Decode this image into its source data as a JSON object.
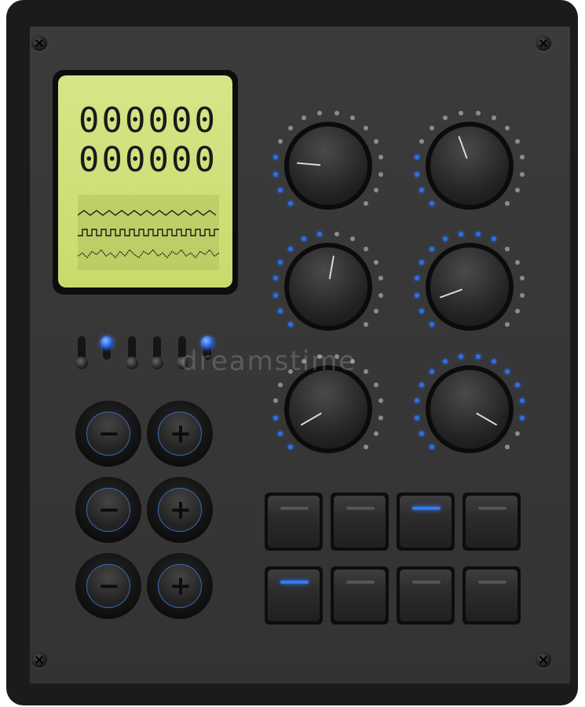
{
  "lcd": {
    "line1": "000000",
    "line2": "000000",
    "background": "#d2e17f",
    "waveforms": [
      "triangle-wave",
      "square-wave",
      "noise-wave"
    ]
  },
  "toggle_switches": [
    {
      "on": false
    },
    {
      "on": true
    },
    {
      "on": false
    },
    {
      "on": false
    },
    {
      "on": false
    },
    {
      "on": true
    }
  ],
  "plus_minus_buttons": [
    {
      "minus": "−",
      "plus": "+"
    },
    {
      "minus": "−",
      "plus": "+"
    },
    {
      "minus": "−",
      "plus": "+"
    }
  ],
  "knobs": [
    {
      "name": "knob-1",
      "angle_deg": 95,
      "leds_on": 4
    },
    {
      "name": "knob-2",
      "angle_deg": 160,
      "leds_on": 4
    },
    {
      "name": "knob-3",
      "angle_deg": 190,
      "leds_on": 8
    },
    {
      "name": "knob-4",
      "angle_deg": 70,
      "leds_on": 10
    },
    {
      "name": "knob-5",
      "angle_deg": 60,
      "leds_on": 3
    },
    {
      "name": "knob-6",
      "angle_deg": 300,
      "leds_on": 14
    }
  ],
  "rocker_switches": [
    {
      "lit": false
    },
    {
      "lit": false
    },
    {
      "lit": true
    },
    {
      "lit": false
    },
    {
      "lit": true
    },
    {
      "lit": false
    },
    {
      "lit": false
    },
    {
      "lit": false
    }
  ],
  "watermark": "dreamstime",
  "colors": {
    "led_on": "#2c6fe6",
    "led_off": "#8c8c8c",
    "panel": "#333333"
  }
}
